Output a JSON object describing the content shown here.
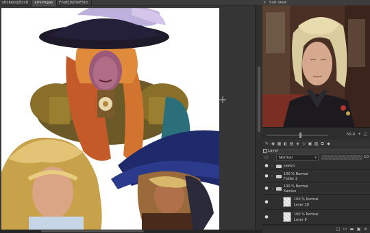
{
  "document_tabs": [
    "stickers|[Eccti",
    "amilmgas",
    "FhaE|[W3eESto"
  ],
  "subview": {
    "title": "Sub View",
    "zoom": "50.0"
  },
  "layer_panel": {
    "tab_label": "Layer",
    "blend_mode": "Normal",
    "opacity_value": "10",
    "layers": [
      {
        "line1": "sketch",
        "line2": ""
      },
      {
        "line1": "100 % Normal",
        "line2": "Folder 2"
      },
      {
        "line1": "100 % Normal",
        "line2": "Kamips"
      },
      {
        "line1": "100 % Normal",
        "line2": "Layer 28"
      },
      {
        "line1": "100 % Normal",
        "line2": "Layer 8"
      }
    ]
  },
  "icons": {
    "eye": "eye-icon",
    "folder": "folder-icon",
    "cursor": "crosshair-icon",
    "lock": "lock-icon"
  }
}
